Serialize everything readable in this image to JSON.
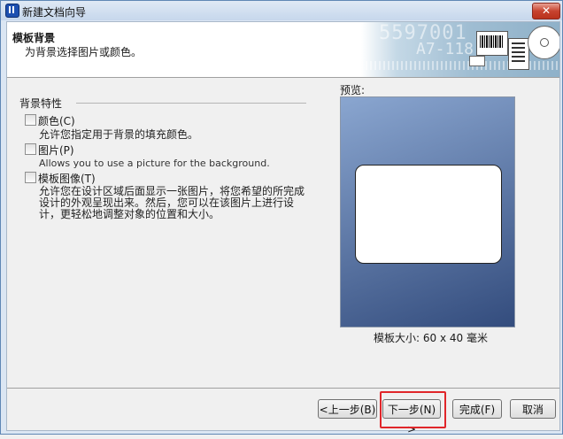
{
  "window": {
    "title": "新建文档向导",
    "close_symbol": "✕"
  },
  "header": {
    "title": "模板背景",
    "subtitle": "为背景选择图片或颜色。",
    "banner_digits": "5597001",
    "banner_code": "A7-118"
  },
  "properties": {
    "section_title": "背景特性",
    "options": [
      {
        "label": "颜色(C)",
        "description": [
          "允许您指定用于背景的填充颜色。"
        ],
        "checked": false
      },
      {
        "label": "图片(P)",
        "description": [
          "Allows you to use a picture for the background."
        ],
        "checked": false
      },
      {
        "label": "模板图像(T)",
        "description": [
          "允许您在设计区域后面显示一张图片，将您希望的所完成",
          "设计的外观呈现出来。然后，您可以在该图片上进行设",
          "计，更轻松地调整对象的位置和大小。"
        ],
        "checked": false
      }
    ]
  },
  "preview": {
    "label": "预览:",
    "size_label": "模板大小: 60 x 40 毫米",
    "colors": {
      "gradient_light": "#8aa6d0",
      "gradient_dark": "#334c7d",
      "card": "#ffffff"
    }
  },
  "buttons": {
    "back": "<上一步(B)",
    "next": "下一步(N) >",
    "finish": "完成(F)",
    "cancel": "取消"
  },
  "accent": {
    "highlight": "#e0262a"
  }
}
